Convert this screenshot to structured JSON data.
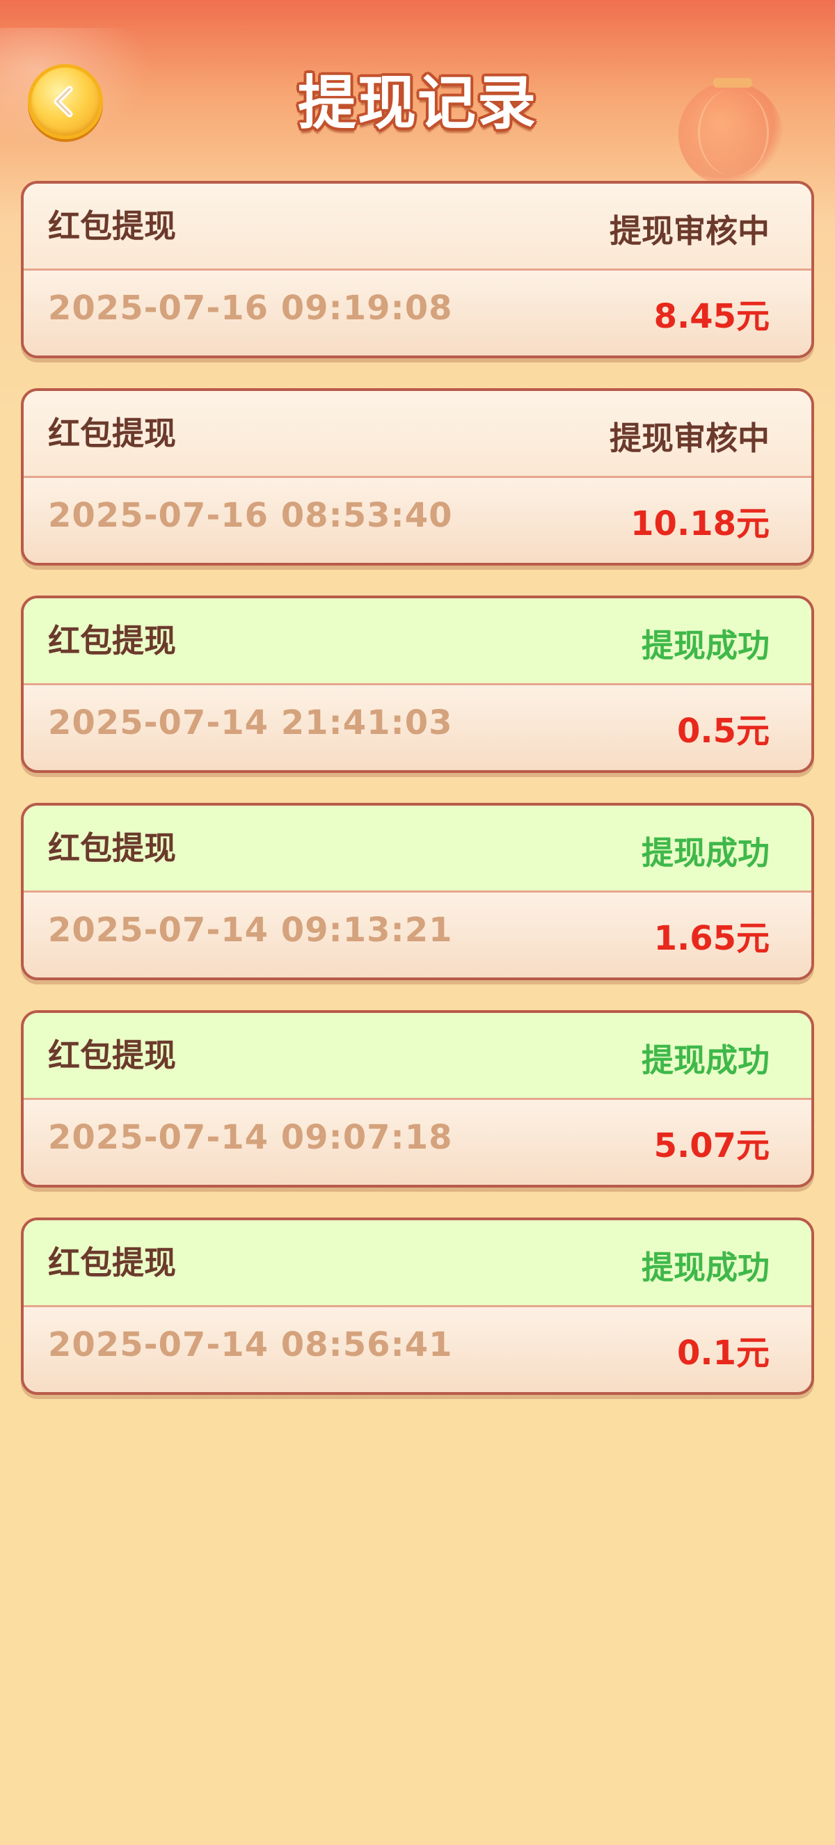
{
  "header": {
    "title": "提现记录",
    "back_icon": "chevron-left-icon"
  },
  "colors": {
    "status_pending": "#6b3a2c",
    "status_success": "#3fb84a",
    "amount": "#e8281c",
    "time": "#d4a27c",
    "accent": "#f0704e"
  },
  "records": [
    {
      "type": "红包提现",
      "status": "提现审核中",
      "state": "pending",
      "time": "2025-07-16 09:19:08",
      "amount": "8.45元"
    },
    {
      "type": "红包提现",
      "status": "提现审核中",
      "state": "pending",
      "time": "2025-07-16 08:53:40",
      "amount": "10.18元"
    },
    {
      "type": "红包提现",
      "status": "提现成功",
      "state": "success",
      "time": "2025-07-14 21:41:03",
      "amount": "0.5元"
    },
    {
      "type": "红包提现",
      "status": "提现成功",
      "state": "success",
      "time": "2025-07-14 09:13:21",
      "amount": "1.65元"
    },
    {
      "type": "红包提现",
      "status": "提现成功",
      "state": "success",
      "time": "2025-07-14 09:07:18",
      "amount": "5.07元"
    },
    {
      "type": "红包提现",
      "status": "提现成功",
      "state": "success",
      "time": "2025-07-14 08:56:41",
      "amount": "0.1元"
    }
  ]
}
